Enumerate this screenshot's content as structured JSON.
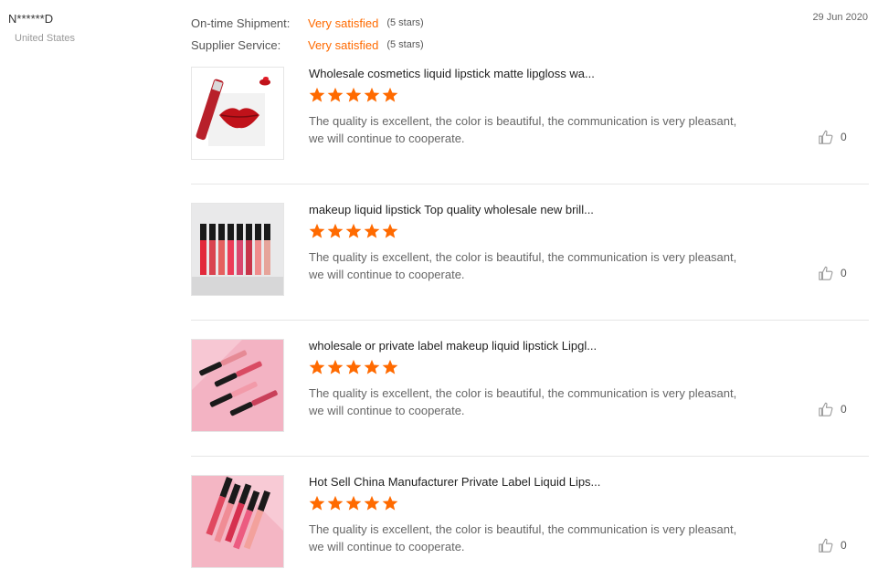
{
  "reviewer": {
    "name": "N******D",
    "country": "United States"
  },
  "ratings": [
    {
      "label": "On-time Shipment:",
      "value": "Very satisfied",
      "stars": "(5 stars)"
    },
    {
      "label": "Supplier Service:",
      "value": "Very satisfied",
      "stars": "(5 stars)"
    }
  ],
  "date": "29 Jun 2020",
  "colors": {
    "accent": "#ff6a00",
    "star": "#ff6a00",
    "divider": "#e6e6e6"
  },
  "products": [
    {
      "title": "Wholesale cosmetics liquid lipstick matte lipgloss wa...",
      "rating": 5,
      "comment_line1": "The quality is excellent, the color is beautiful, the communication is very pleasant,",
      "comment_line2": "we will continue to cooperate.",
      "likes": "0",
      "thumb_icon": "lipstick-lips-image"
    },
    {
      "title": "makeup liquid lipstick Top quality wholesale new brill...",
      "rating": 5,
      "comment_line1": "The quality is excellent, the color is beautiful, the communication is very pleasant,",
      "comment_line2": "we will continue to cooperate.",
      "likes": "0",
      "thumb_icon": "lipgloss-row-image"
    },
    {
      "title": "wholesale or private label makeup liquid lipstick Lipgl...",
      "rating": 5,
      "comment_line1": "The quality is excellent, the color is beautiful, the communication is very pleasant,",
      "comment_line2": "we will continue to cooperate.",
      "likes": "0",
      "thumb_icon": "lipgloss-pink-image"
    },
    {
      "title": "Hot Sell China Manufacturer Private Label Liquid Lips...",
      "rating": 5,
      "comment_line1": "The quality is excellent, the color is beautiful, the communication is very pleasant,",
      "comment_line2": "we will continue to cooperate.",
      "likes": "0",
      "thumb_icon": "lipgloss-bundle-image"
    }
  ]
}
